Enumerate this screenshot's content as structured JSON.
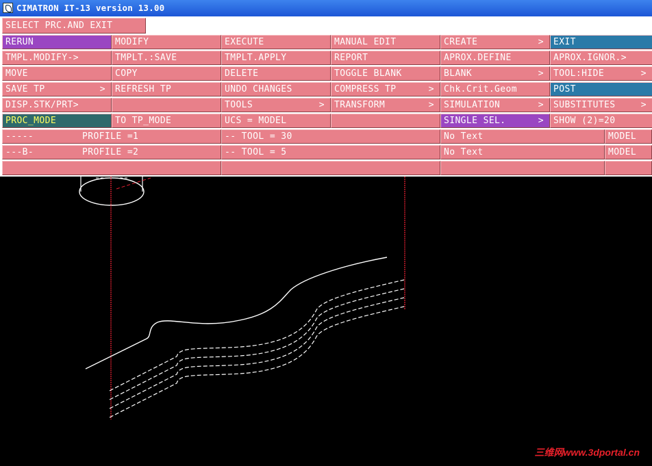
{
  "window": {
    "title": "CIMATRON IT-13 version 13.00"
  },
  "prompt": "SELECT PRC.AND EXIT",
  "menu": {
    "rows": [
      [
        {
          "label": "RERUN",
          "style": "purple"
        },
        {
          "label": "MODIFY"
        },
        {
          "label": "EXECUTE"
        },
        {
          "label": "MANUAL EDIT"
        },
        {
          "label": "CREATE",
          "arrow": ">"
        },
        {
          "label": "EXIT",
          "style": "blue"
        }
      ],
      [
        {
          "label": "TMPL.MODIFY->"
        },
        {
          "label": "TMPLT.:SAVE"
        },
        {
          "label": "TMPLT.APPLY"
        },
        {
          "label": "REPORT"
        },
        {
          "label": "APROX.DEFINE"
        },
        {
          "label": "APROX.IGNOR.>"
        }
      ],
      [
        {
          "label": "MOVE"
        },
        {
          "label": "COPY"
        },
        {
          "label": "DELETE"
        },
        {
          "label": "TOGGLE BLANK"
        },
        {
          "label": "BLANK",
          "arrow": ">"
        },
        {
          "label": "TOOL:HIDE",
          "arrow": ">"
        }
      ],
      [
        {
          "label": "SAVE TP",
          "arrow": ">"
        },
        {
          "label": "REFRESH TP"
        },
        {
          "label": "UNDO CHANGES"
        },
        {
          "label": "COMPRESS TP",
          "arrow": ">"
        },
        {
          "label": "Chk.Crit.Geom"
        },
        {
          "label": "POST",
          "style": "blue"
        }
      ],
      [
        {
          "label": "DISP.STK/PRT>"
        },
        {
          "label": ""
        },
        {
          "label": "TOOLS",
          "arrow": ">"
        },
        {
          "label": "TRANSFORM",
          "arrow": ">"
        },
        {
          "label": "SIMULATION",
          "arrow": ">"
        },
        {
          "label": "SUBSTITUTES",
          "arrow": ">"
        }
      ],
      [
        {
          "label": "PROC_MODE",
          "style": "teal"
        },
        {
          "label": "TO TP_MODE"
        },
        {
          "label": "UCS = MODEL"
        },
        {
          "label": ""
        },
        {
          "label": "SINGLE SEL.",
          "arrow": ">",
          "style": "purple"
        },
        {
          "label": "SHOW (2)=20"
        }
      ]
    ]
  },
  "procedures": [
    {
      "marker": "-----",
      "name": "PROFILE =1",
      "tool": "-- TOOL = 30",
      "text": "No Text",
      "ucs": "MODEL"
    },
    {
      "marker": "---B-",
      "name": "PROFILE =2",
      "tool": "-- TOOL = 5",
      "text": "No Text",
      "ucs": "MODEL"
    },
    {
      "marker": "",
      "name": "",
      "tool": "",
      "text": "",
      "ucs": ""
    }
  ],
  "watermark": "三维网www.3dportal.cn"
}
